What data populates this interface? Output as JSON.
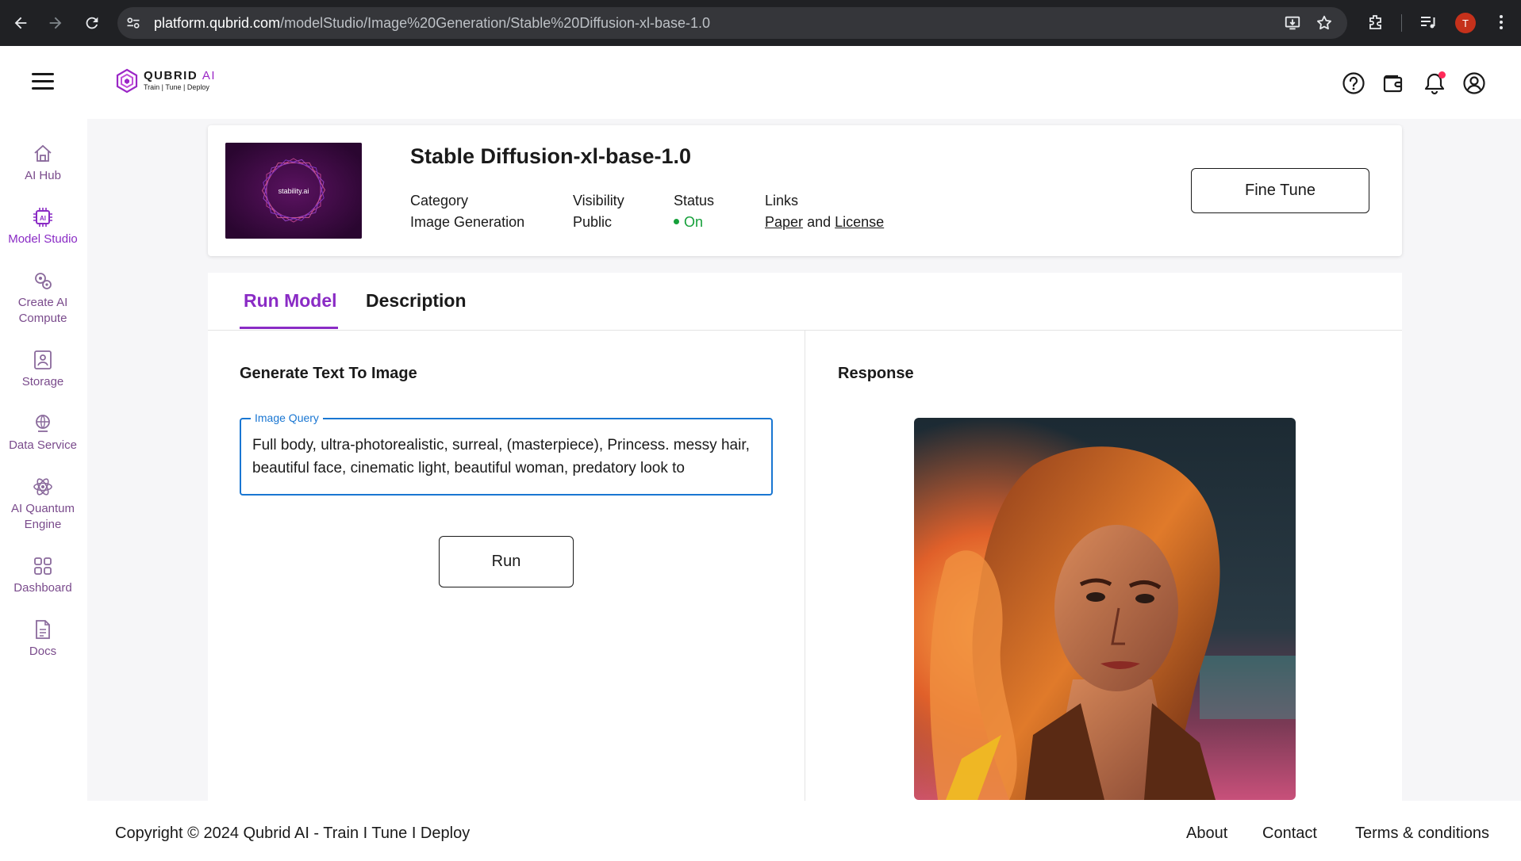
{
  "browser": {
    "url_host": "platform.qubrid.com",
    "url_path": "/modelStudio/Image%20Generation/Stable%20Diffusion-xl-base-1.0",
    "profile_initial": "T"
  },
  "header": {
    "brand_main": "QUBRID",
    "brand_accent": "AI",
    "tagline": "Train | Tune | Deploy"
  },
  "sidebar": {
    "items": [
      {
        "label": "AI Hub"
      },
      {
        "label": "Model Studio"
      },
      {
        "label": "Create AI Compute"
      },
      {
        "label": "Storage"
      },
      {
        "label": "Data Service"
      },
      {
        "label": "AI Quantum Engine"
      },
      {
        "label": "Dashboard"
      },
      {
        "label": "Docs"
      }
    ]
  },
  "model": {
    "thumbnail_text": "stability.ai",
    "title": "Stable Diffusion-xl-base-1.0",
    "category_label": "Category",
    "category_value": "Image Generation",
    "visibility_label": "Visibility",
    "visibility_value": "Public",
    "status_label": "Status",
    "status_value": "On",
    "links_label": "Links",
    "link_paper": "Paper",
    "link_and": "and",
    "link_license": "License",
    "fine_tune_label": "Fine Tune"
  },
  "tabs": [
    {
      "label": "Run Model",
      "active": true
    },
    {
      "label": "Description",
      "active": false
    }
  ],
  "run": {
    "section_title": "Generate Text To Image",
    "query_label": "Image Query",
    "query_value": "Full body, ultra-photorealistic, surreal, (masterpiece), Princess. messy hair, beautiful face, cinematic light, beautiful woman, predatory look to",
    "run_label": "Run",
    "response_title": "Response"
  },
  "footer": {
    "copyright": "Copyright © 2024 Qubrid AI - Train I Tune I Deploy",
    "about": "About",
    "contact": "Contact",
    "terms": "Terms & conditions"
  },
  "colors": {
    "accent": "#8a2bc5",
    "status_on": "#15a03a",
    "input_focus": "#1976d2"
  }
}
